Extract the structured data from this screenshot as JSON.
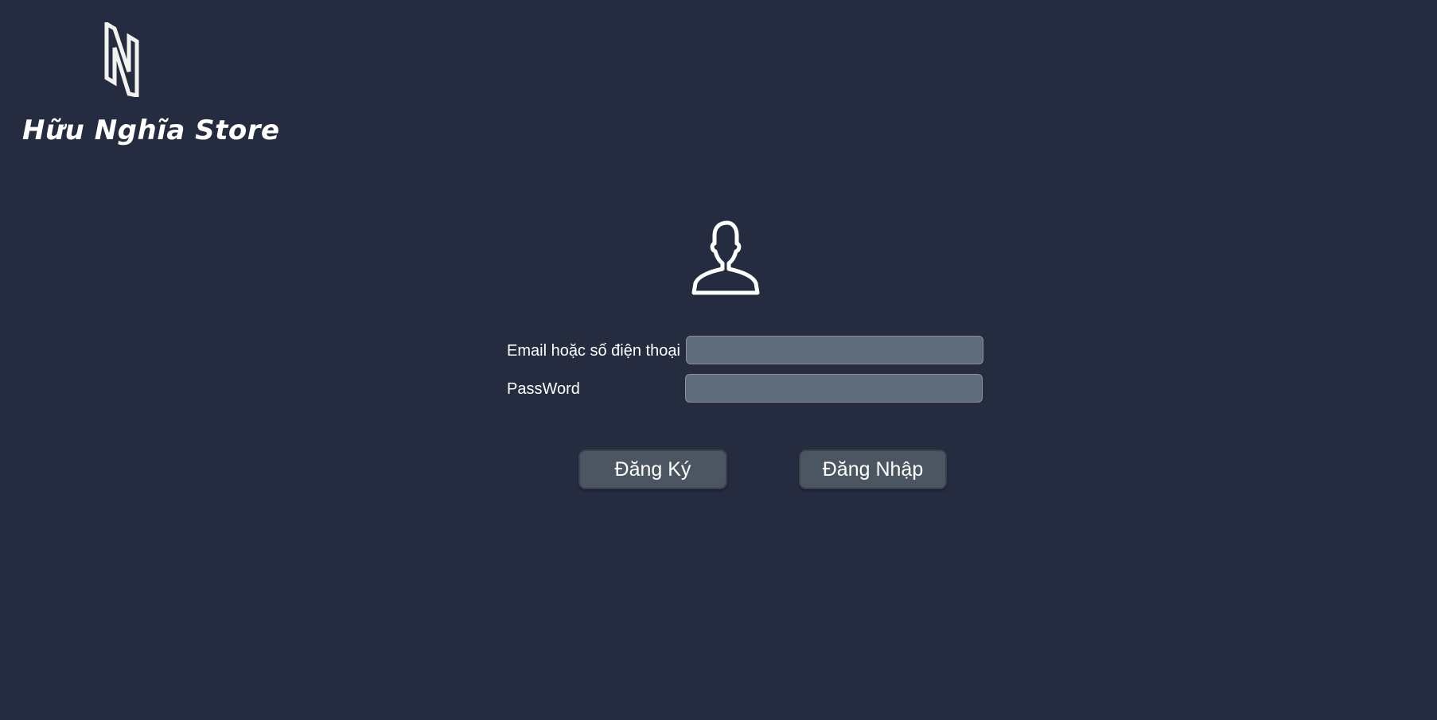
{
  "brand": {
    "name": "Hữu Nghĩa Store",
    "logo_icon": "n-monogram-logo"
  },
  "login": {
    "avatar_icon": "user-icon",
    "email_label": "Email hoặc số điện thoại",
    "email_value": "",
    "password_label": "PassWord",
    "password_value": "",
    "register_label": "Đăng Ký",
    "login_label": "Đăng Nhập"
  },
  "colors": {
    "background": "#262c40",
    "input_background": "#5e6b78",
    "button_background": "#4c5663",
    "text": "#ffffff"
  }
}
